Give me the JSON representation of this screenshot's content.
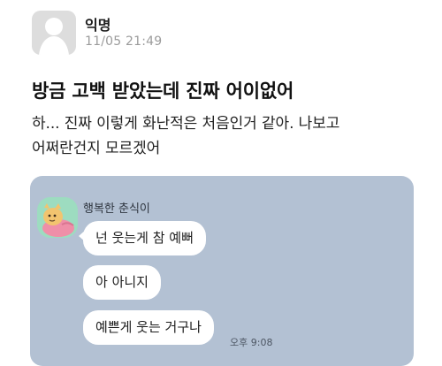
{
  "header": {
    "author": "익명",
    "timestamp": "11/05 21:49",
    "avatar_icon": "anonymous-user-icon"
  },
  "post": {
    "title": "방금 고백 받았는데 진짜 어이없어",
    "body_lines": [
      "하... 진짜 이렇게 화난적은 처음인거 같아. 나보고",
      "어쩌란건지 모르겠어"
    ]
  },
  "chat": {
    "background_color": "#b3c1d3",
    "sender_name": "행복한 춘식이",
    "sender_avatar_icon": "chunsik-character-icon",
    "messages": [
      "넌 웃는게 참 예뻐",
      "아 아니지",
      "예쁜게 웃는 거구나"
    ],
    "time": "오후 9:08"
  }
}
